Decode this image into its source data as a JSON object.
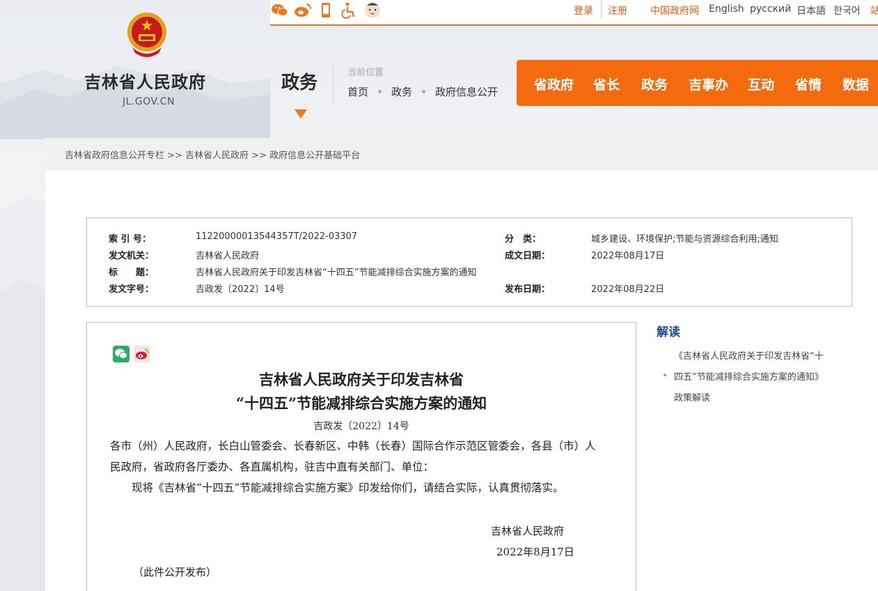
{
  "site": {
    "name": "吉林省人民政府",
    "domain": "JL.GOV.CN",
    "section": "政务"
  },
  "topbar": {
    "social_icons": [
      "wechat-icon",
      "weibo-icon",
      "mobile-icon",
      "accessibility-icon",
      "mascot-icon"
    ],
    "login": "登录",
    "register": "注册",
    "gov_link": "中国政府网",
    "languages": [
      "English",
      "русский",
      "日本語",
      "한국어",
      "站"
    ]
  },
  "location": {
    "label": "当前位置",
    "crumbs": [
      "首页",
      "政务",
      "政府信息公开"
    ]
  },
  "main_nav": [
    "省政府",
    "省长",
    "政务",
    "吉事办",
    "互动",
    "省情",
    "数据"
  ],
  "breadcrumb_bar": "吉林省政府信息公开专栏 >> 吉林省人民政府 >> 政府信息公开基础平台",
  "meta": {
    "index_no_label": "索 引 号：",
    "index_no": "11220000013544357T/2022-03307",
    "category_label": "分　类：",
    "category": "城乡建设、环境保护;节能与资源综合利用;通知",
    "issuer_label": "发文机关：",
    "issuer": "吉林省人民政府",
    "created_label": "成文日期：",
    "created": "2022年08月17日",
    "title_label": "标　　题：",
    "title": "吉林省人民政府关于印发吉林省“十四五”节能减排综合实施方案的通知",
    "docno_label": "发文字号：",
    "docno": "吉政发〔2022〕14号",
    "published_label": "发布日期：",
    "published": "2022年08月22日"
  },
  "article": {
    "title_line1": "吉林省人民政府关于印发吉林省",
    "title_line2": "“十四五”节能减排综合实施方案的通知",
    "docno": "吉政发〔2022〕14号",
    "body_line1": "各市（州）人民政府，长白山管委会、长春新区、中韩（长春）国际合作示范区管委会，各县（市）人",
    "body_line2": "民政府，省政府各厅委办、各直属机构，驻吉中直有关部门、单位：",
    "body_line3": "现将《吉林省“十四五”节能减排综合实施方案》印发给你们，请结合实际，认真贯彻落实。",
    "signer": "吉林省人民政府",
    "sign_date": "2022年8月17日",
    "note": "（此件公开发布）"
  },
  "interpretation": {
    "heading": "解读",
    "line1": "《吉林省人民政府关于印发吉林省“十",
    "line2": "四五”节能减排综合实施方案的通知》",
    "line3": "政策解读"
  },
  "colors": {
    "accent": "#f36a0f",
    "link_blue": "#1f4e8c"
  }
}
